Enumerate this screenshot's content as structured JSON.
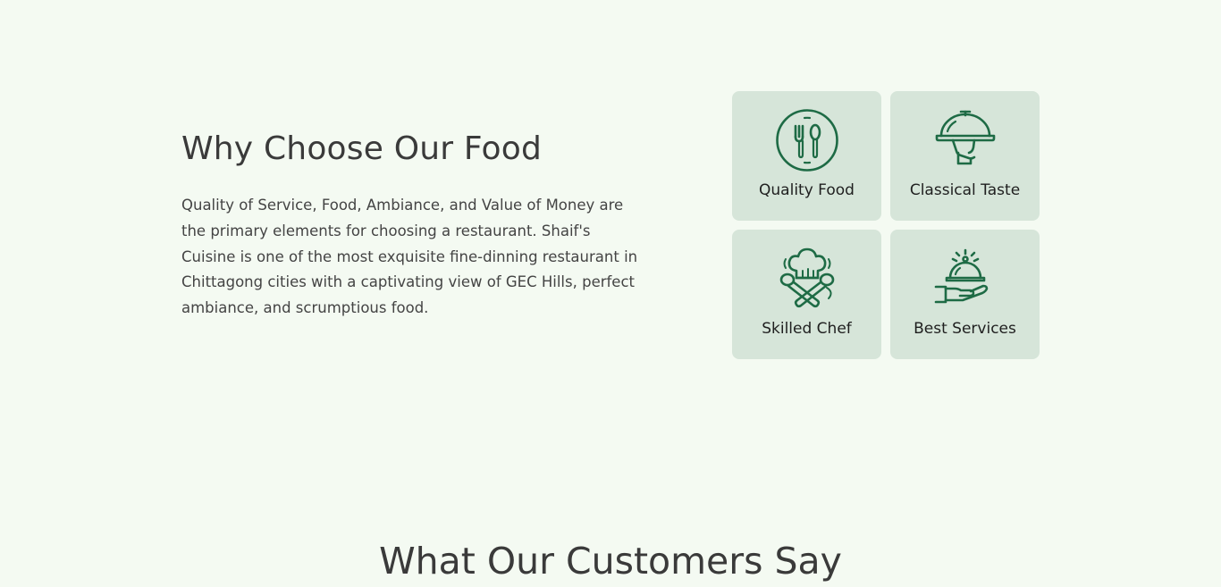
{
  "why_section": {
    "title": "Why Choose Our Food",
    "description": "Quality of Service, Food, Ambiance, and Value of Money are the primary elements for choosing a restaurant. Shaif's Cuisine is one of the most exquisite fine-dinning restaurant in Chittagong cities with a captivating view of GEC Hills, perfect ambiance, and scrumptious food.",
    "features": [
      {
        "label": "Quality Food",
        "icon": "plate-fork-spoon-icon"
      },
      {
        "label": "Classical Taste",
        "icon": "serving-cloche-icon"
      },
      {
        "label": "Skilled Chef",
        "icon": "chef-hat-utensils-icon"
      },
      {
        "label": "Best Services",
        "icon": "hand-serving-cloche-icon"
      }
    ]
  },
  "testimonials_section": {
    "title": "What Our Customers Say"
  },
  "colors": {
    "background": "#f4faf2",
    "card": "#d6e5d9",
    "icon_stroke": "#1e6b45",
    "heading": "#3a3a3a"
  }
}
